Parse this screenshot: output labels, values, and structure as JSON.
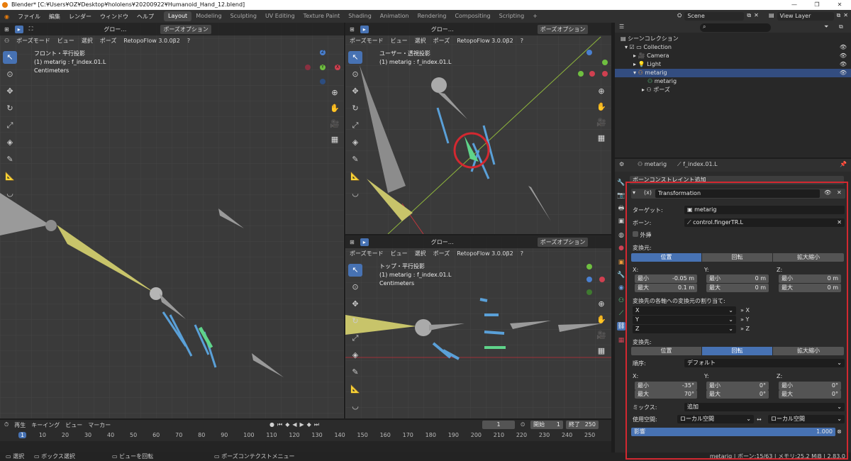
{
  "window": {
    "title": "Blender* [C:¥Users¥OZ¥Desktop¥hololens¥20200922¥Humanoid_Hand_12.blend]"
  },
  "topbar": {
    "menus": [
      "ファイル",
      "編集",
      "レンダー",
      "ウィンドウ",
      "ヘルプ"
    ],
    "workspaces": [
      "Layout",
      "Modeling",
      "Sculpting",
      "UV Editing",
      "Texture Paint",
      "Shading",
      "Animation",
      "Rendering",
      "Compositing",
      "Scripting"
    ],
    "add_tab": "+",
    "scene": "Scene",
    "view_layer": "View Layer"
  },
  "viewport_header": {
    "global": "グロー…",
    "mode": "ポーズモード",
    "view": "ビュー",
    "select": "選択",
    "pose": "ポーズ",
    "addon": "RetopoFlow 3.0.0β2",
    "pose_options": "ポーズオプション"
  },
  "viewport_left": {
    "name": "フロント・平行投影",
    "object": "(1) metarig : f_index.01.L",
    "units": "Centimeters"
  },
  "viewport_top_right": {
    "name": "ユーザー・透視投影",
    "object": "(1) metarig : f_index.01.L"
  },
  "viewport_bottom_right": {
    "name": "トップ・平行投影",
    "object": "(1) metarig : f_index.01.L",
    "units": "Centimeters"
  },
  "outliner": {
    "title": "シーンコレクション",
    "rows": [
      {
        "label": "Collection"
      },
      {
        "label": "Camera"
      },
      {
        "label": "Light"
      },
      {
        "label": "metarig"
      },
      {
        "label": "metarig"
      },
      {
        "label": "ポーズ"
      }
    ]
  },
  "properties": {
    "breadcrumb_object": "metarig",
    "breadcrumb_bone": "f_index.01.L",
    "add_constraint": "ボーンコンストレイント追加",
    "constraint_name": "Transformation",
    "target_label": "ターゲット:",
    "target_value": "metarig",
    "bone_label": "ボーン:",
    "bone_value": "control.fingerTR.L",
    "extrapolate": "外挿",
    "source_label": "変換元:",
    "source_modes": [
      "位置",
      "回転",
      "拡大縮小"
    ],
    "axis_x": "X:",
    "axis_y": "Y:",
    "axis_z": "Z:",
    "min": "最小",
    "max": "最大",
    "src_x_min": "-0.05 m",
    "src_x_max": "0.1 m",
    "src_y_min": "0 m",
    "src_y_max": "0 m",
    "src_z_min": "0 m",
    "src_z_max": "0 m",
    "mapping_label": "変換先の各軸への変換元の割り当て:",
    "map": [
      {
        "src": "X",
        "dst": "» X"
      },
      {
        "src": "Y",
        "dst": "» Y"
      },
      {
        "src": "Z",
        "dst": "» Z"
      }
    ],
    "dest_label": "変換先:",
    "dest_modes": [
      "位置",
      "回転",
      "拡大縮小"
    ],
    "order_label": "順序:",
    "order_value": "デフォルト",
    "dst_x_min": "-35°",
    "dst_x_max": "70°",
    "dst_y_min": "0°",
    "dst_y_max": "0°",
    "dst_z_min": "0°",
    "dst_z_max": "0°",
    "mix_label": "ミックス:",
    "mix_value": "追加",
    "space_label": "使用空間:",
    "space_owner": "ローカル空間",
    "space_target": "ローカル空間",
    "influence_label": "影響",
    "influence_value": "1.000",
    "influence_fraction": 1.0
  },
  "timeline": {
    "playback": "再生",
    "keying": "キーイング",
    "view": "ビュー",
    "marker": "マーカー",
    "current_frame": "1",
    "start_label": "開始",
    "start": "1",
    "end_label": "終了",
    "end": "250",
    "ticks": [
      "1",
      "10",
      "20",
      "30",
      "40",
      "50",
      "60",
      "70",
      "80",
      "90",
      "100",
      "110",
      "120",
      "130",
      "140",
      "150",
      "160",
      "170",
      "180",
      "190",
      "200",
      "210",
      "220",
      "230",
      "240",
      "250"
    ]
  },
  "statusbar": {
    "select": "選択",
    "box_select": "ボックス選択",
    "rotate_view": "ビューを回転",
    "context_menu": "ポーズコンテクストメニュー",
    "stats": "metarig | ボーン:15/63 | メモリ:25.2 MiB | 2.83.0"
  },
  "colors": {
    "accent": "#4772b3",
    "highlight": "#d32830",
    "bone_yellow": "#c8c46a",
    "bone_blue": "#5aa0d8",
    "bone_green": "#5fd48a"
  }
}
